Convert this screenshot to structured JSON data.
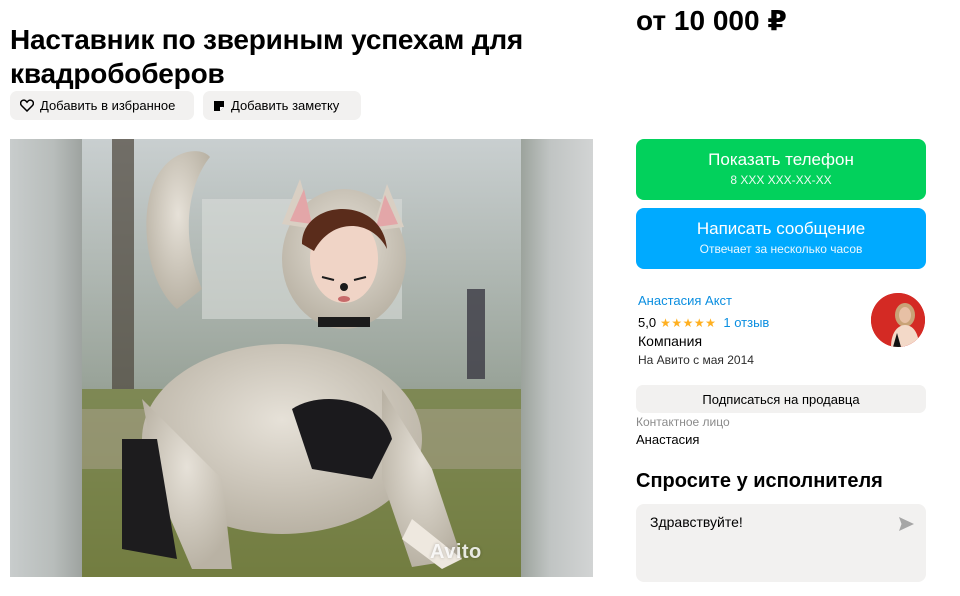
{
  "listing": {
    "title": "Наставник по звериным успехам для квадробоберов",
    "price": "от 10 000 ₽"
  },
  "actions": {
    "favorite_label": "Добавить в избранное",
    "note_label": "Добавить заметку"
  },
  "gallery": {
    "watermark": "Avito"
  },
  "contact": {
    "show_phone_label": "Показать телефон",
    "phone_mask": "8 XXX XXX-XX-XX",
    "message_label": "Написать сообщение",
    "message_sub": "Отвечает за несколько часов"
  },
  "seller": {
    "name": "Анастасия Акст",
    "rating": "5,0",
    "stars": "★★★★★",
    "reviews": "1 отзыв",
    "type": "Компания",
    "since": "На Авито с мая 2014",
    "subscribe_label": "Подписаться на продавца",
    "contact_label": "Контактное лицо",
    "contact_name": "Анастасия"
  },
  "ask": {
    "title": "Спросите у исполнителя",
    "message_value": "Здравствуйте!"
  },
  "colors": {
    "green": "#02d15c",
    "blue": "#00aaff",
    "link": "#0a8ee0",
    "star": "#ffb021",
    "chip_bg": "#f2f1f0"
  },
  "icons": [
    "heart-icon",
    "note-icon",
    "send-icon"
  ]
}
